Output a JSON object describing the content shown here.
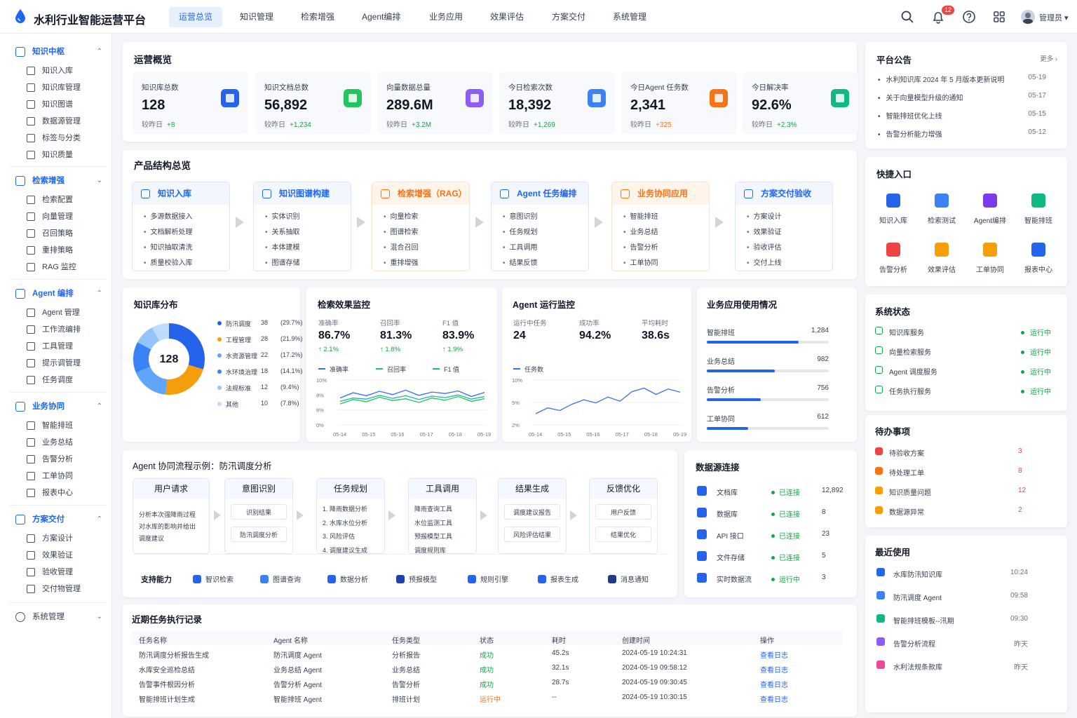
{
  "app": {
    "title": "水利行业智能运营平台",
    "user": "管理员",
    "notifications": "12"
  },
  "nav": [
    "运营总览",
    "知识管理",
    "检索增强",
    "Agent编排",
    "业务应用",
    "效果评估",
    "方案交付",
    "系统管理"
  ],
  "sidebar": [
    {
      "label": "知识中枢",
      "items": [
        "知识入库",
        "知识库管理",
        "知识图谱",
        "数据源管理",
        "标签与分类",
        "知识质量"
      ]
    },
    {
      "label": "检索增强",
      "items": [
        "检索配置",
        "向量管理",
        "召回策略",
        "重排策略",
        "RAG 监控"
      ]
    },
    {
      "label": "Agent 编排",
      "items": [
        "Agent 管理",
        "工作流编排",
        "工具管理",
        "提示调管理",
        "任务调度"
      ]
    },
    {
      "label": "业务协同",
      "items": [
        "智能排班",
        "业务总结",
        "告警分析",
        "工单协同",
        "报表中心"
      ]
    },
    {
      "label": "方案交付",
      "items": [
        "方案设计",
        "效果验证",
        "验收管理",
        "交付物管理"
      ]
    },
    {
      "label": "系统管理",
      "items": []
    }
  ],
  "overview": {
    "title": "运营概览",
    "stats": [
      {
        "label": "知识库总数",
        "value": "128",
        "cmp": "较昨日",
        "delta": "+8",
        "color": "#16a34a",
        "icon": "database-icon",
        "ic": "#2563eb"
      },
      {
        "label": "知识文档总数",
        "value": "56,892",
        "cmp": "较昨日",
        "delta": "+1,234",
        "color": "#16a34a",
        "icon": "document-icon",
        "ic": "#22c55e"
      },
      {
        "label": "向量数据总量",
        "value": "289.6M",
        "cmp": "较昨日",
        "delta": "+3.2M",
        "color": "#16a34a",
        "icon": "cube-icon",
        "ic": "#8b5cf6"
      },
      {
        "label": "今日检索次数",
        "value": "18,392",
        "cmp": "较昨日",
        "delta": "+1,269",
        "color": "#16a34a",
        "icon": "search-icon",
        "ic": "#3b82f6"
      },
      {
        "label": "今日Agent 任务数",
        "value": "2,341",
        "cmp": "较昨日",
        "delta": "+325",
        "color": "#f97316",
        "icon": "robot-icon",
        "ic": "#f97316"
      },
      {
        "label": "今日解决率",
        "value": "92.6%",
        "cmp": "较昨日",
        "delta": "+2.3%",
        "color": "#16a34a",
        "icon": "resolve-icon",
        "ic": "#10b981"
      }
    ]
  },
  "product": {
    "title": "产品结构总览",
    "boxes": [
      {
        "title": "知识入库",
        "items": [
          "多源数据接入",
          "文档解析处理",
          "知识抽取清洗",
          "质量校验入库"
        ],
        "orange": false
      },
      {
        "title": "知识图谱构建",
        "items": [
          "实体识别",
          "关系抽取",
          "本体建模",
          "图谱存储"
        ],
        "orange": false
      },
      {
        "title": "检索增强（RAG）",
        "items": [
          "向量检索",
          "图谱检索",
          "混合召回",
          "重排增强"
        ],
        "orange": true
      },
      {
        "title": "Agent 任务编排",
        "items": [
          "意图识别",
          "任务规划",
          "工具调用",
          "结果反馈"
        ],
        "orange": false
      },
      {
        "title": "业务协同应用",
        "items": [
          "智能排班",
          "业务总结",
          "告警分析",
          "工单协同"
        ],
        "orange": true
      },
      {
        "title": "方案交付验收",
        "items": [
          "方案设计",
          "效果验证",
          "验收评估",
          "交付上线"
        ],
        "orange": false
      }
    ]
  },
  "kbdist": {
    "title": "知识库分布",
    "center": "128",
    "legend": [
      {
        "name": "防汛调度",
        "count": "38",
        "pct": "(29.7%)",
        "color": "#2563eb",
        "v": 38
      },
      {
        "name": "工程管理",
        "count": "28",
        "pct": "(21.9%)",
        "color": "#f59e0b",
        "v": 28
      },
      {
        "name": "水资源管理",
        "count": "22",
        "pct": "(17.2%)",
        "color": "#60a5fa",
        "v": 22
      },
      {
        "name": "水环境治理",
        "count": "18",
        "pct": "(14.1%)",
        "color": "#3b82f6",
        "v": 18
      },
      {
        "name": "法规标准",
        "count": "12",
        "pct": "(9.4%)",
        "color": "#93c5fd",
        "v": 12
      },
      {
        "name": "其他",
        "count": "10",
        "pct": "(7.8%)",
        "color": "#bfdbfe",
        "v": 10
      }
    ]
  },
  "retrieval": {
    "title": "检索效果监控",
    "metrics": [
      {
        "label": "准确率",
        "value": "86.7%",
        "delta": "↑ 2.1%"
      },
      {
        "label": "召回率",
        "value": "81.3%",
        "delta": "↑ 1.8%"
      },
      {
        "label": "F1 值",
        "value": "83.9%",
        "delta": "↑ 1.9%"
      }
    ],
    "legend": [
      "准确率",
      "召回率",
      "F1 值"
    ],
    "chart_data": {
      "type": "line",
      "x": [
        "05-14",
        "05-15",
        "05-16",
        "05-17",
        "05-18",
        "05-19"
      ],
      "yticks": [
        "10%",
        "8%",
        "6%",
        "0%"
      ],
      "series": [
        {
          "name": "准确率",
          "color": "#3b6ff0",
          "values": [
            7.2,
            8.6,
            7.8,
            9.0,
            8.1,
            9.3,
            7.9,
            8.8,
            8.4,
            9.1,
            7.6,
            8.7
          ]
        },
        {
          "name": "召回率",
          "color": "#22c55e",
          "values": [
            5.6,
            6.8,
            6.2,
            7.4,
            6.5,
            7.0,
            6.0,
            7.2,
            6.6,
            7.6,
            6.3,
            7.0
          ]
        },
        {
          "name": "F1 值",
          "color": "#14b8a6",
          "values": [
            6.3,
            7.2,
            6.9,
            7.9,
            7.1,
            7.8,
            6.8,
            7.7,
            7.3,
            8.0,
            6.9,
            7.6
          ]
        }
      ]
    }
  },
  "agentmon": {
    "title": "Agent 运行监控",
    "metrics": [
      {
        "label": "运行中任务",
        "value": "24"
      },
      {
        "label": "成功率",
        "value": "94.2%"
      },
      {
        "label": "平均耗时",
        "value": "38.6s"
      }
    ],
    "legend": "任务数",
    "chart_data": {
      "type": "line",
      "x": [
        "05-14",
        "05-15",
        "05-16",
        "05-17",
        "05-18",
        "05-19"
      ],
      "yticks": [
        "10%",
        "5%",
        "2%"
      ],
      "series": [
        {
          "name": "任务数",
          "color": "#3b6ff0",
          "values": [
            2.5,
            3.8,
            3.2,
            4.6,
            5.6,
            4.9,
            6.2,
            5.3,
            7.4,
            8.2,
            6.8,
            8.0,
            7.3
          ]
        }
      ]
    }
  },
  "biz": {
    "title": "业务应用使用情况",
    "rows": [
      {
        "name": "智能排班",
        "value": "1,284",
        "frac": 0.75
      },
      {
        "name": "业务总结",
        "value": "982",
        "frac": 0.56
      },
      {
        "name": "告警分析",
        "value": "756",
        "frac": 0.44
      },
      {
        "name": "工单协同",
        "value": "612",
        "frac": 0.34
      }
    ]
  },
  "flow": {
    "title": "Agent 协同流程示例：防汛调度分析",
    "steps": [
      {
        "title": "用户请求",
        "lines": [
          "分析本次强降雨过程",
          "对水库的影响并给出",
          "调度建议"
        ]
      },
      {
        "title": "意图识别",
        "boxes": [
          "识别结果",
          "防汛调度分析"
        ]
      },
      {
        "title": "任务规划",
        "lines": [
          "1. 降雨数据分析",
          "2. 水库水位分析",
          "3. 风险评估",
          "4. 调度建议生成"
        ]
      },
      {
        "title": "工具调用",
        "lines": [
          "降雨查询工具",
          "水位监测工具",
          "预报模型工具",
          "调度规则库"
        ]
      },
      {
        "title": "结果生成",
        "boxes": [
          "调度建议报告",
          "风险评估结果"
        ]
      },
      {
        "title": "反馈优化",
        "boxes": [
          "用户反馈",
          "结果优化"
        ]
      }
    ],
    "cap_label": "支持能力",
    "caps": [
      {
        "name": "智识检索",
        "c": "#2563eb"
      },
      {
        "name": "图谱查询",
        "c": "#3b82f6"
      },
      {
        "name": "数据分析",
        "c": "#2563eb"
      },
      {
        "name": "预报模型",
        "c": "#1e40af"
      },
      {
        "name": "规则引擎",
        "c": "#2563eb"
      },
      {
        "name": "报表生成",
        "c": "#2563eb"
      },
      {
        "name": "消息通知",
        "c": "#1e3a8a"
      }
    ]
  },
  "datasrc": {
    "title": "数据源连接",
    "rows": [
      {
        "name": "文档库",
        "status": "已连接",
        "count": "12,892"
      },
      {
        "name": "数据库",
        "status": "已连接",
        "count": "8"
      },
      {
        "name": "API 接口",
        "status": "已连接",
        "count": "23"
      },
      {
        "name": "文件存储",
        "status": "已连接",
        "count": "5"
      },
      {
        "name": "实时数据流",
        "status": "运行中",
        "count": "3"
      }
    ]
  },
  "tasks": {
    "title": "近期任务执行记录",
    "headers": [
      "任务名称",
      "Agent 名称",
      "任务类型",
      "状态",
      "耗时",
      "创建时间",
      "操作"
    ],
    "rows": [
      [
        "防汛调度分析报告生成",
        "防汛调度 Agent",
        "分析报告",
        "成功",
        "45.2s",
        "2024-05-19 10:24:31",
        "查看日志"
      ],
      [
        "水库安全巡检总结",
        "业务总结 Agent",
        "业务总结",
        "成功",
        "32.1s",
        "2024-05-19 09:58:12",
        "查看日志"
      ],
      [
        "告警事件根因分析",
        "告警分析 Agent",
        "告警分析",
        "成功",
        "28.7s",
        "2024-05-19 09:30:45",
        "查看日志"
      ],
      [
        "智能排班计划生成",
        "智能排班 Agent",
        "排班计划",
        "运行中",
        "--",
        "2024-05-19 10:30:15",
        "查看日志"
      ]
    ]
  },
  "announce": {
    "title": "平台公告",
    "more": "更多 ›",
    "items": [
      {
        "t": "水利知识库 2024 年 5 月版本更新说明",
        "d": "05-19"
      },
      {
        "t": "关于向量模型升级的通知",
        "d": "05-17"
      },
      {
        "t": "智能排班优化上线",
        "d": "05-15"
      },
      {
        "t": "告警分析能力增强",
        "d": "05-12"
      }
    ]
  },
  "quick": {
    "title": "快捷入口",
    "items": [
      {
        "n": "知识入库",
        "c": "#2563eb"
      },
      {
        "n": "检索测试",
        "c": "#3b82f6"
      },
      {
        "n": "Agent编排",
        "c": "#7c3aed"
      },
      {
        "n": "智能排班",
        "c": "#10b981"
      },
      {
        "n": "告警分析",
        "c": "#ef4444"
      },
      {
        "n": "效果评估",
        "c": "#f59e0b"
      },
      {
        "n": "工单协同",
        "c": "#f59e0b"
      },
      {
        "n": "报表中心",
        "c": "#2563eb"
      }
    ]
  },
  "sysstatus": {
    "title": "系统状态",
    "rows": [
      {
        "n": "知识库服务",
        "s": "运行中"
      },
      {
        "n": "向量检索服务",
        "s": "运行中"
      },
      {
        "n": "Agent 调度服务",
        "s": "运行中"
      },
      {
        "n": "任务执行服务",
        "s": "运行中"
      }
    ]
  },
  "todo": {
    "title": "待办事项",
    "rows": [
      {
        "n": "待验收方案",
        "c": "3",
        "col": "#ef4444"
      },
      {
        "n": "待处理工单",
        "c": "8",
        "col": "#f97316"
      },
      {
        "n": "知识质量问题",
        "c": "12",
        "col": "#f59e0b"
      },
      {
        "n": "数据源异常",
        "c": "2",
        "col": "#f59e0b"
      }
    ]
  },
  "recent": {
    "title": "最近使用",
    "rows": [
      {
        "n": "水库防汛知识库",
        "t": "10:24",
        "col": "#2563eb"
      },
      {
        "n": "防汛调度 Agent",
        "t": "09:58",
        "col": "#3b82f6"
      },
      {
        "n": "智能排班模板--汛期",
        "t": "09:30",
        "col": "#10b981"
      },
      {
        "n": "告警分析流程",
        "t": "昨天",
        "col": "#8b5cf6"
      },
      {
        "n": "水利法规条款库",
        "t": "昨天",
        "col": "#ec4899"
      }
    ]
  }
}
